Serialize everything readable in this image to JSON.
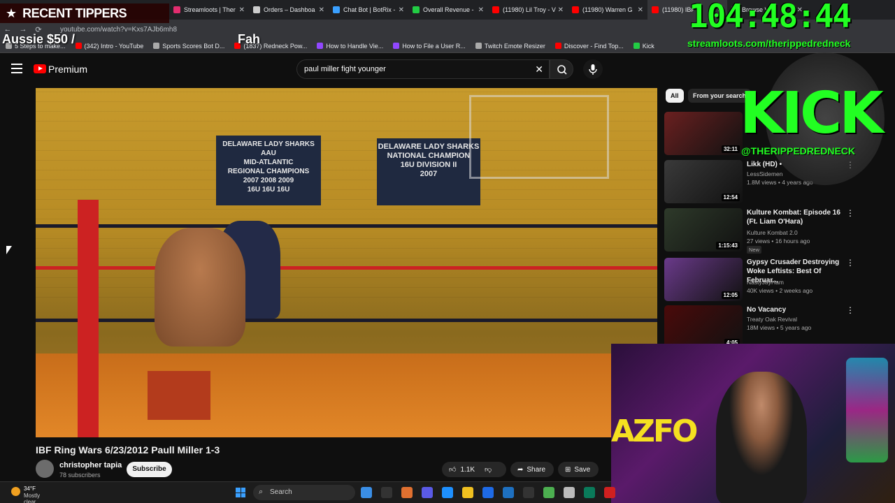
{
  "browser": {
    "tabs": [
      {
        "label": "Streamloots | Ther",
        "color": "#e22d6f"
      },
      {
        "label": "Orders – Dashboa",
        "color": "#cccccc"
      },
      {
        "label": "Chat Bot | BotRix -",
        "color": "#3aa0ff"
      },
      {
        "label": "Overall Revenue -",
        "color": "#22cc44"
      },
      {
        "label": "(11980) Lil Troy - V",
        "color": "#ff0000"
      },
      {
        "label": "(11980) Warren G",
        "color": "#ff0000"
      },
      {
        "label": "(11980) IBF R",
        "color": "#ff0000"
      },
      {
        "label": "Browse Vids",
        "color": "#888888"
      }
    ],
    "url": "youtube.com/watch?v=Kxs7AJb6mh8",
    "bookmarks": [
      {
        "label": "5 Steps to make...",
        "color": "#aaaaaa"
      },
      {
        "label": "(342) Intro - YouTube",
        "color": "#ff0000"
      },
      {
        "label": "Sports Scores Bot D...",
        "color": "#aaaaaa"
      },
      {
        "label": "(1837) Redneck Pow...",
        "color": "#ff0000"
      },
      {
        "label": "How to Handle Vie...",
        "color": "#9147ff"
      },
      {
        "label": "How to File a User R...",
        "color": "#9147ff"
      },
      {
        "label": "Twitch Emote Resizer",
        "color": "#aaaaaa"
      },
      {
        "label": "Discover - Find Top...",
        "color": "#ff0000"
      },
      {
        "label": "Kick",
        "color": "#22cc44"
      }
    ]
  },
  "overlay": {
    "recent_title": "RECENT TIPPERS",
    "tipper_entry": "Aussie $50 /",
    "tipper_entry_2": "Fah",
    "timer": "104:48:44",
    "streamloots_url": "streamloots.com/therippedredneck",
    "kick_text": "KICK",
    "kick_handle": "@THERIPPEDREDNECK",
    "webcam_sign": "AZFO"
  },
  "youtube": {
    "brand": "Premium",
    "search_value": "paul miller fight younger",
    "search_placeholder": "Search",
    "video_title": "IBF Ring Wars 6/23/2012 Paull Miller 1-3",
    "channel_name": "christopher tapia",
    "subscribers": "78 subscribers",
    "subscribe_label": "Subscribe",
    "like_count": "1.1K",
    "share_label": "Share",
    "save_label": "Save",
    "banners": [
      {
        "text": "DELAWARE LADY SHARKS AAU\nMID-ATLANTIC\nREGIONAL CHAMPIONS\n2007  2008  2009\n16U  16U  16U"
      },
      {
        "text": "DELAWARE LADY SHARKS\nNATIONAL CHAMPION\n16U DIVISION II\n2007"
      }
    ],
    "chips": [
      "All",
      "From your search"
    ],
    "recommendations": [
      {
        "title": "",
        "channel": "",
        "meta": "",
        "duration": "32:11",
        "is_new": false,
        "thumb": "#6a2020"
      },
      {
        "title": "Likk (HD) •",
        "channel": "LessSidemen",
        "meta": "1.8M views • 4 years ago",
        "duration": "12:54",
        "is_new": false,
        "thumb": "#3a3a3a"
      },
      {
        "title": "Kulture Kombat: Episode 16 (Ft. Liam O'Hara)",
        "channel": "Kulture Kombat 2.0",
        "meta": "27 views • 16 hours ago",
        "duration": "1:15:43",
        "is_new": true,
        "thumb": "#2e3a2a"
      },
      {
        "title": "Gypsy Crusader Destroying Woke Leftists: Best Of Februar...",
        "channel": "NastyJayHam",
        "meta": "40K views • 2 weeks ago",
        "duration": "12:05",
        "is_new": false,
        "thumb": "#6a3a8a"
      },
      {
        "title": "No Vacancy",
        "channel": "Treaty Oak Revival",
        "meta": "18M views • 5 years ago",
        "duration": "4:05",
        "is_new": false,
        "thumb": "#4a0a0a"
      }
    ],
    "new_badge": "New"
  },
  "taskbar": {
    "temperature": "34°F",
    "weather": "Mostly clear",
    "search_label": "Search",
    "icon_colors": [
      "#3a8ee6",
      "#333333",
      "#e07030",
      "#5a5ae6",
      "#1e90ff",
      "#f0c020",
      "#1e6ae6",
      "#1e70c0",
      "#333333",
      "#4caf50",
      "#bbbbbb",
      "#0a7a5a",
      "#d02020"
    ]
  },
  "colors": {
    "youtube_red": "#ff0000",
    "neon_green": "#22ff22",
    "background": "#0f0f0f"
  }
}
